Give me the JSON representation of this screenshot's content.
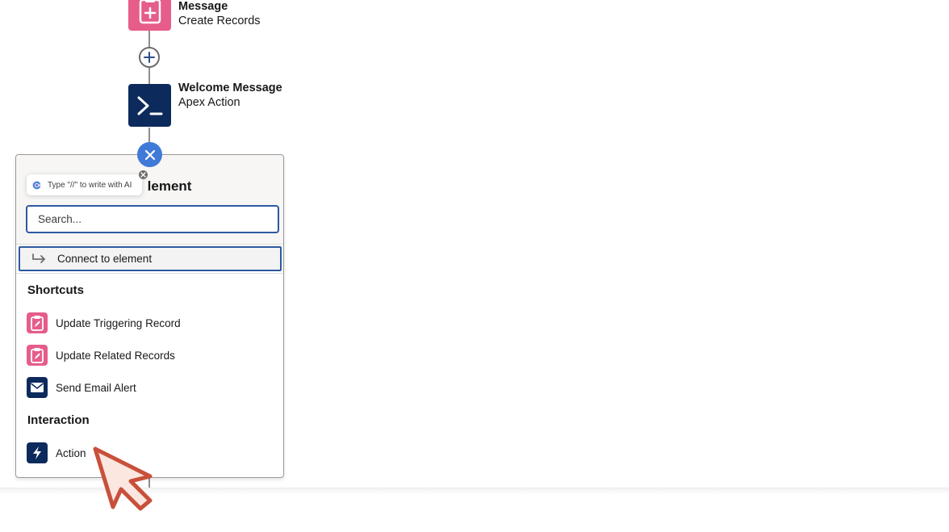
{
  "flow": {
    "nodes": [
      {
        "title": "Message",
        "subtitle": "Create Records",
        "icon": "create-records-icon"
      },
      {
        "title": "Welcome Message",
        "subtitle": "Apex Action",
        "icon": "apex-terminal-icon"
      }
    ]
  },
  "panel": {
    "title_visible": "lement",
    "ai_tip": "Type \"//\" to write with AI",
    "search": {
      "placeholder": "Search...",
      "value": ""
    },
    "connect_label": "Connect to element",
    "sections": [
      {
        "heading": "Shortcuts",
        "items": [
          {
            "label": "Update Triggering Record",
            "icon": "clipboard-edit-icon",
            "color": "#e65d8a"
          },
          {
            "label": "Update Related Records",
            "icon": "clipboard-edit-icon",
            "color": "#e65d8a"
          },
          {
            "label": "Send Email Alert",
            "icon": "email-icon",
            "color": "#0d2a5c"
          }
        ]
      },
      {
        "heading": "Interaction",
        "items": [
          {
            "label": "Action",
            "icon": "lightning-icon",
            "color": "#0d2a5c"
          }
        ]
      }
    ]
  },
  "colors": {
    "pink": "#e65d8a",
    "navy": "#0d2a5c",
    "blue": "#3f7ad8",
    "focus": "#2d5aa0",
    "cursor": "#c8503a"
  }
}
